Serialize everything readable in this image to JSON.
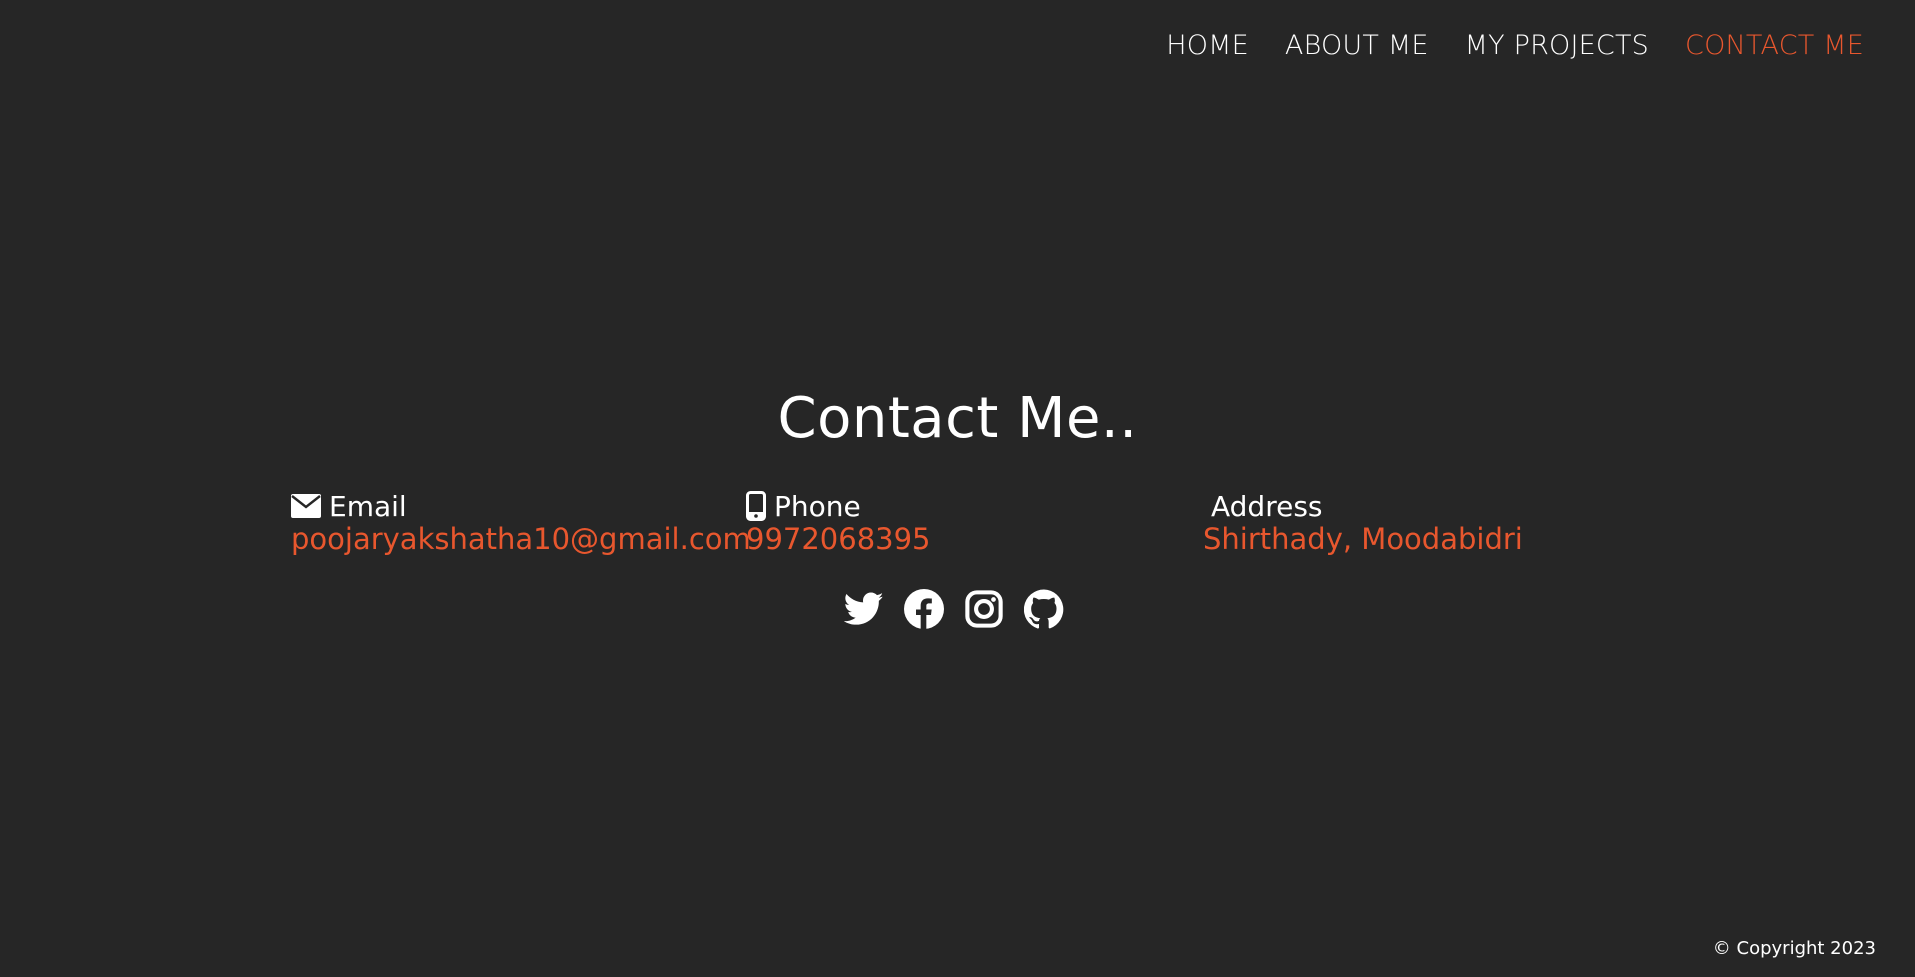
{
  "nav": {
    "items": [
      {
        "label": "HOME",
        "active": false
      },
      {
        "label": "ABOUT ME",
        "active": false
      },
      {
        "label": "MY PROJECTS",
        "active": false
      },
      {
        "label": "CONTACT ME",
        "active": true
      }
    ]
  },
  "main": {
    "title": "Contact Me.."
  },
  "contact": {
    "email": {
      "label": "Email",
      "value": "poojaryakshatha10@gmail.com",
      "icon": "envelope-icon"
    },
    "phone": {
      "label": "Phone",
      "value": "9972068395",
      "icon": "mobile-phone-icon"
    },
    "address": {
      "label": "Address",
      "value": "Shirthady, Moodabidri"
    }
  },
  "social": {
    "icons": [
      "twitter-icon",
      "facebook-icon",
      "instagram-icon",
      "github-icon"
    ]
  },
  "footer": {
    "copyright": "© Copyright 2023"
  },
  "colors": {
    "background": "#262626",
    "accent": "#e8572e",
    "text": "#ffffff"
  }
}
